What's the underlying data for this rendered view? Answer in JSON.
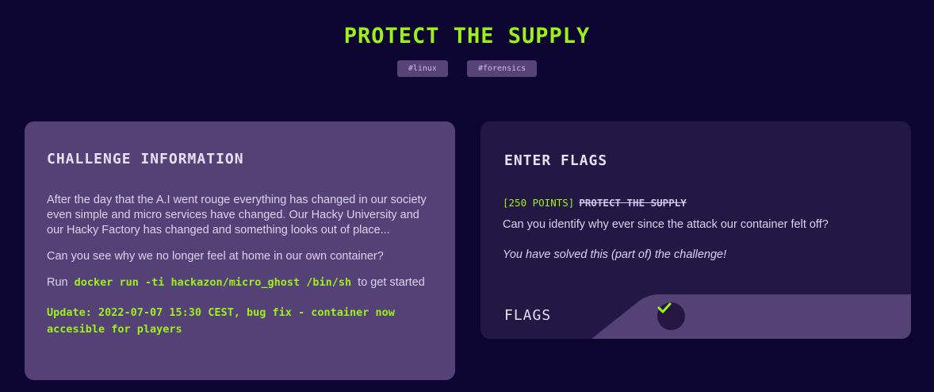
{
  "header": {
    "title": "PROTECT THE SUPPLY",
    "tags": [
      "#linux",
      "#forensics"
    ]
  },
  "challenge_info": {
    "heading": "CHALLENGE INFORMATION",
    "paragraph1": "After the day that the A.I went rouge everything has changed in our society even simple and micro services have changed. Our Hacky University and our Hacky Factory has changed and something looks out of place...",
    "paragraph2": "Can you see why we no longer feel at home in our own container?",
    "run_prefix": "Run",
    "run_command": "docker run -ti hackazon/micro_ghost /bin/sh",
    "run_suffix": "to get started",
    "update": "Update: 2022-07-07 15:30 CEST, bug fix - container now accesible for players"
  },
  "enter_flags": {
    "heading": "ENTER FLAGS",
    "points": "[250 POINTS]",
    "challenge_name": "PROTECT THE SUPPLY",
    "question": "Can you identify why ever since the attack our container felt off?",
    "solved_message": "You have solved this (part of) the challenge!",
    "flags_label": "FLAGS",
    "status_icon": "check-icon"
  },
  "colors": {
    "background": "#0d0630",
    "accent": "#9ef01a",
    "card_left": "#544277",
    "card_right": "#231843"
  }
}
